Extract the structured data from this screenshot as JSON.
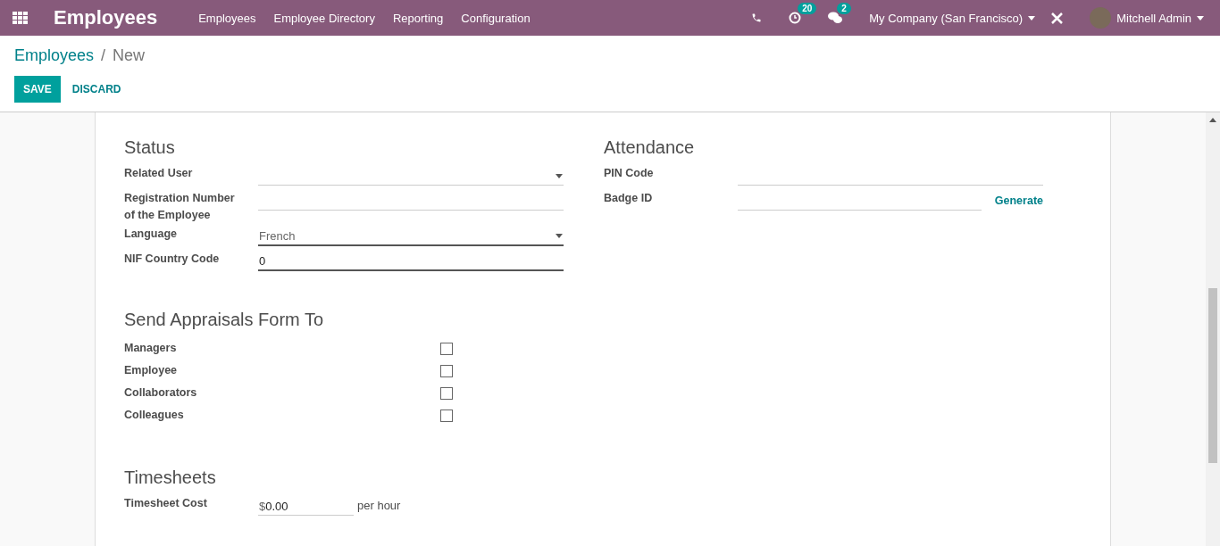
{
  "navbar": {
    "app_title": "Employees",
    "menu": [
      {
        "label": "Employees"
      },
      {
        "label": "Employee Directory"
      },
      {
        "label": "Reporting"
      },
      {
        "label": "Configuration"
      }
    ],
    "activity_count": "20",
    "message_count": "2",
    "company": "My Company (San Francisco)",
    "user": "Mitchell Admin"
  },
  "breadcrumb": {
    "parent": "Employees",
    "separator": "/",
    "current": "New"
  },
  "buttons": {
    "save": "SAVE",
    "discard": "DISCARD"
  },
  "status": {
    "title": "Status",
    "fields": [
      {
        "label": "Related User",
        "kind": "select",
        "emphasized": false
      },
      {
        "label": "Registration Number of the Employee",
        "kind": "text",
        "emphasized": false
      },
      {
        "label": "Language",
        "kind": "select",
        "value": "French",
        "emphasized": true
      },
      {
        "label": "NIF Country Code",
        "kind": "text",
        "value": "0",
        "emphasized": true
      }
    ]
  },
  "attendance": {
    "title": "Attendance",
    "fields": [
      {
        "label": "PIN Code",
        "kind": "text"
      },
      {
        "label": "Badge ID",
        "kind": "action",
        "action": "Generate"
      }
    ]
  },
  "appraisals": {
    "title": "Send Appraisals Form To",
    "options": [
      {
        "label": "Managers",
        "checked": false
      },
      {
        "label": "Employee",
        "checked": false
      },
      {
        "label": "Collaborators",
        "checked": false
      },
      {
        "label": "Colleagues",
        "checked": false
      }
    ]
  },
  "timesheets": {
    "title": "Timesheets",
    "cost_label": "Timesheet Cost",
    "currency": "$",
    "cost_value": "0.00",
    "unit": "per hour"
  }
}
